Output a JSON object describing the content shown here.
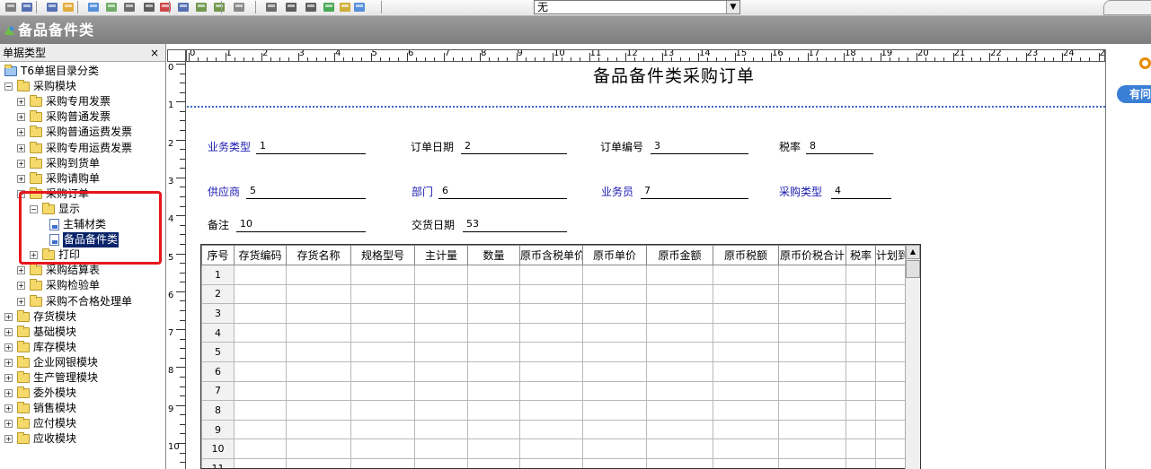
{
  "toolbar": {
    "combo_value": "无",
    "combo_arrow": "▼",
    "icons": [
      "print-icon",
      "save-icon",
      "save-as-icon",
      "design-icon",
      "props-icon",
      "copy-format-icon",
      "font-icon",
      "page-setup-icon",
      "delete-icon",
      "insert-icon",
      "group-icon",
      "ungroup-icon",
      "align-icon",
      "border-icon",
      "line-icon",
      "tab-order-icon",
      "refresh-icon",
      "lock-icon",
      "layer-icon"
    ]
  },
  "window": {
    "title": "备品备件类"
  },
  "left_pane": {
    "header": "单据类型",
    "close": "×",
    "tree": [
      {
        "label": "T6单据目录分类",
        "level": 0,
        "kind": "root"
      },
      {
        "label": "采购模块",
        "level": 0,
        "kind": "folder",
        "exp": "−"
      },
      {
        "label": "采购专用发票",
        "level": 1,
        "kind": "folder",
        "exp": "+"
      },
      {
        "label": "采购普通发票",
        "level": 1,
        "kind": "folder",
        "exp": "+"
      },
      {
        "label": "采购普通运费发票",
        "level": 1,
        "kind": "folder",
        "exp": "+"
      },
      {
        "label": "采购专用运费发票",
        "level": 1,
        "kind": "folder",
        "exp": "+"
      },
      {
        "label": "采购到货单",
        "level": 1,
        "kind": "folder",
        "exp": "+"
      },
      {
        "label": "采购请购单",
        "level": 1,
        "kind": "folder",
        "exp": "+"
      },
      {
        "label": "采购订单",
        "level": 1,
        "kind": "folder",
        "exp": "−"
      },
      {
        "label": "显示",
        "level": 2,
        "kind": "folder",
        "exp": "−"
      },
      {
        "label": "主辅材类",
        "level": 3,
        "kind": "doc"
      },
      {
        "label": "备品备件类",
        "level": 3,
        "kind": "doc",
        "selected": true
      },
      {
        "label": "打印",
        "level": 2,
        "kind": "folder",
        "exp": "+"
      },
      {
        "label": "采购结算表",
        "level": 1,
        "kind": "folder",
        "exp": "+"
      },
      {
        "label": "采购检验单",
        "level": 1,
        "kind": "folder",
        "exp": "+"
      },
      {
        "label": "采购不合格处理单",
        "level": 1,
        "kind": "folder",
        "exp": "+"
      },
      {
        "label": "存货模块",
        "level": 0,
        "kind": "folder",
        "exp": "+"
      },
      {
        "label": "基础模块",
        "level": 0,
        "kind": "folder",
        "exp": "+"
      },
      {
        "label": "库存模块",
        "level": 0,
        "kind": "folder",
        "exp": "+"
      },
      {
        "label": "企业网银模块",
        "level": 0,
        "kind": "folder",
        "exp": "+"
      },
      {
        "label": "生产管理模块",
        "level": 0,
        "kind": "folder",
        "exp": "+"
      },
      {
        "label": "委外模块",
        "level": 0,
        "kind": "folder",
        "exp": "+"
      },
      {
        "label": "销售模块",
        "level": 0,
        "kind": "folder",
        "exp": "+"
      },
      {
        "label": "应付模块",
        "level": 0,
        "kind": "folder",
        "exp": "+"
      },
      {
        "label": "应收模块",
        "level": 0,
        "kind": "folder",
        "exp": "+"
      }
    ]
  },
  "ruler": {
    "h_ticks": [
      "0",
      "1",
      "2",
      "3",
      "4",
      "5",
      "6",
      "7",
      "8",
      "9",
      "10",
      "11",
      "12",
      "13",
      "14",
      "15",
      "16",
      "17",
      "18",
      "19",
      "20",
      "21",
      "22",
      "23",
      "24",
      "25"
    ],
    "v_ticks": [
      "0",
      "1",
      "2",
      "3",
      "4",
      "5",
      "6",
      "7",
      "8",
      "9",
      "10"
    ]
  },
  "form": {
    "title": "备品备件类采购订单",
    "fields": [
      {
        "label": "业务类型",
        "value": "1",
        "blue": true
      },
      {
        "label": "订单日期",
        "value": "2",
        "blue": false
      },
      {
        "label": "订单编号",
        "value": "3",
        "blue": false
      },
      {
        "label": "税率",
        "value": "8",
        "blue": false
      },
      {
        "label": "供应商",
        "value": "5",
        "blue": true
      },
      {
        "label": "部门",
        "value": "6",
        "blue": true
      },
      {
        "label": "业务员",
        "value": "7",
        "blue": true
      },
      {
        "label": "采购类型",
        "value": "4",
        "blue": true
      },
      {
        "label": "备注",
        "value": "10",
        "blue": false
      },
      {
        "label": "交货日期",
        "value": "53",
        "blue": false
      }
    ]
  },
  "grid": {
    "columns": [
      "序号",
      "存货编码",
      "存货名称",
      "规格型号",
      "主计量",
      "数量",
      "原币含税单价",
      "原币单价",
      "原币金额",
      "原币税额",
      "原币价税合计",
      "税率",
      "计划到货日期"
    ],
    "rows": [
      "1",
      "2",
      "3",
      "4",
      "5",
      "6",
      "7",
      "8",
      "9",
      "10",
      "11"
    ],
    "scroll_up": "▲"
  },
  "side": {
    "help": "有问"
  },
  "colors": {
    "selection": "#0a246a",
    "highlight_box": "#e8161c",
    "blue_label": "#1a1ab0",
    "dotted_rule": "#3f66c8"
  }
}
